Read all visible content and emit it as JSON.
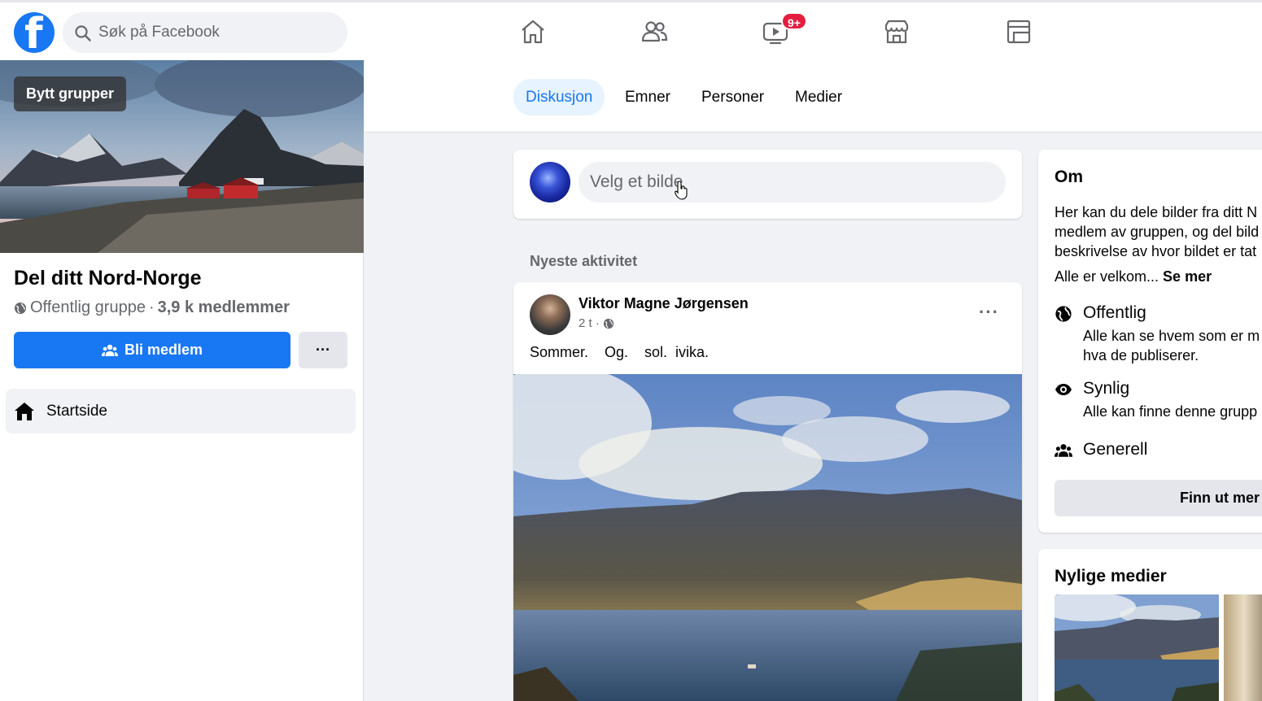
{
  "topbar": {
    "logo_letter": "f",
    "search_placeholder": "Søk på Facebook",
    "nav_icons": [
      "home-icon",
      "friends-icon",
      "watch-icon",
      "marketplace-icon",
      "groups-icon"
    ],
    "watch_badge": "9+"
  },
  "group": {
    "switch_label": "Bytt grupper",
    "name": "Del ditt Nord-Norge",
    "privacy": "Offentlig gruppe",
    "separator": " · ",
    "members": "3,9 k medlemmer",
    "join_label": "Bli medlem",
    "more_label": "···",
    "home_label": "Startside"
  },
  "tabs": [
    "Diskusjon",
    "Emner",
    "Personer",
    "Medier"
  ],
  "composer": {
    "placeholder": "Velg et bilde"
  },
  "feed": {
    "section_label": "Nyeste aktivitet",
    "post": {
      "author": "Viktor Magne Jørgensen",
      "time": "2 t ·",
      "text": "Sommer.    Og.    sol.  ivika.",
      "more_label": "···"
    }
  },
  "about": {
    "title": "Om",
    "desc_lines": [
      "Her kan du dele bilder fra ditt N",
      "medlem av gruppen, og del bild",
      "beskrivelse av hvor bildet er tat"
    ],
    "more_prefix": "Alle er velkom... ",
    "more_link": "Se mer",
    "items": [
      {
        "title": "Offentlig",
        "sub1": "Alle kan se hvem som er m",
        "sub2": "hva de publiserer."
      },
      {
        "title": "Synlig",
        "sub1": "Alle kan finne denne grupp",
        "sub2": ""
      },
      {
        "title": "Generell",
        "sub1": "",
        "sub2": ""
      }
    ],
    "learn_more": "Finn ut mer"
  },
  "media": {
    "title": "Nylige medier"
  },
  "colors": {
    "brand": "#1877f2",
    "badge": "#e41e3f",
    "background": "#f0f2f5"
  }
}
